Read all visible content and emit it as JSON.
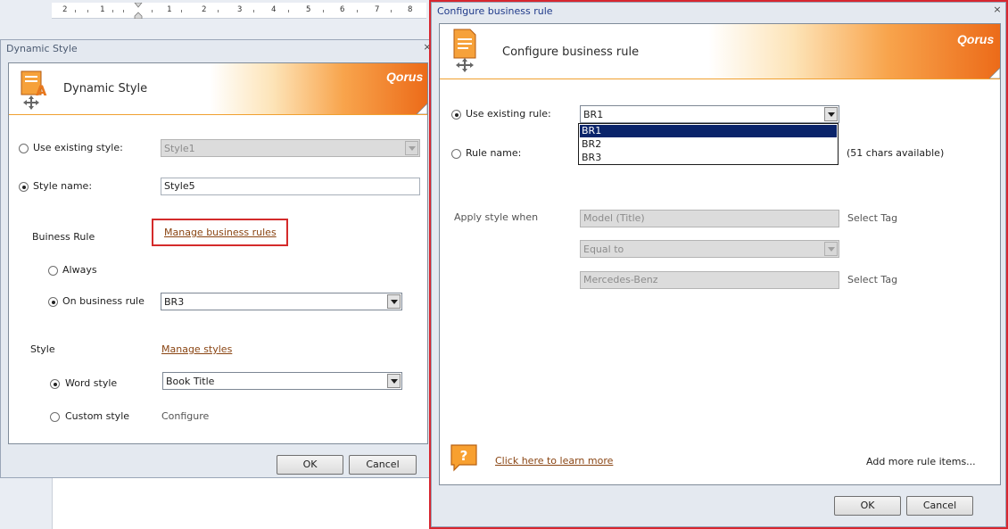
{
  "ruler": {
    "numbers": [
      "2",
      "1",
      "1",
      "2",
      "3",
      "4",
      "5",
      "6",
      "7",
      "8"
    ]
  },
  "dynamic_style": {
    "title": "Dynamic Style",
    "close": "×",
    "header_title": "Dynamic Style",
    "brand": "Qorus",
    "use_existing_style": {
      "label": "Use existing style:",
      "value": "Style1",
      "selected": false
    },
    "style_name": {
      "label": "Style name:",
      "value": "Style5",
      "selected": true
    },
    "business_rule": {
      "label": "Buiness Rule",
      "manage_link": "Manage business rules",
      "always_label": "Always",
      "on_rule_label": "On business rule",
      "on_rule_value": "BR3"
    },
    "style": {
      "label": "Style",
      "manage_link": "Manage styles",
      "word_style_label": "Word style",
      "word_style_value": "Book Title",
      "custom_style_label": "Custom style",
      "configure_label": "Configure"
    },
    "ok": "OK",
    "cancel": "Cancel"
  },
  "configure_rule": {
    "title": "Configure business rule",
    "close": "×",
    "header_title": "Configure business rule",
    "brand": "Qorus",
    "use_existing_rule": {
      "label": "Use existing rule:",
      "value": "BR1",
      "selected": true
    },
    "dropdown_options": [
      "BR1",
      "BR2",
      "BR3"
    ],
    "rule_name": {
      "label": "Rule name:",
      "hint": "(51 chars available)",
      "selected": false
    },
    "apply_style_when": "Apply style when",
    "condition": {
      "field": "Model (Title)",
      "operator": "Equal to",
      "value": "Mercedes-Benz",
      "select_tag_1": "Select Tag",
      "select_tag_2": "Select Tag"
    },
    "help_icon_glyph": "?",
    "learn_more_link": "Click here to learn more",
    "add_more_label": "Add more rule items...",
    "ok": "OK",
    "cancel": "Cancel"
  },
  "colors": {
    "highlight_red": "#d42b2b",
    "brand_orange": "#ec6b19",
    "link_brown": "#8a4513",
    "selection_navy": "#0a246a"
  }
}
